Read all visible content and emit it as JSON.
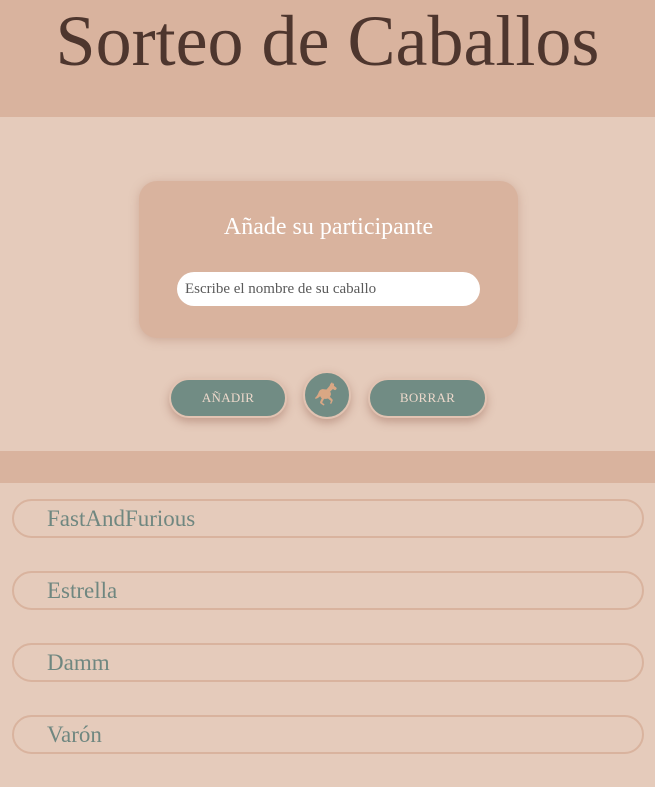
{
  "header": {
    "title": "Sorteo de Caballos"
  },
  "form": {
    "title": "Añade su participante",
    "input_placeholder": "Escribe el nombre de su caballo",
    "input_value": ""
  },
  "actions": {
    "add_label": "AÑADIR",
    "horse_icon": "horse-icon",
    "clear_label": "BORRAR"
  },
  "participants": [
    {
      "name": "FastAndFurious"
    },
    {
      "name": "Estrella"
    },
    {
      "name": "Damm"
    },
    {
      "name": "Varón"
    }
  ],
  "colors": {
    "page_background": "#e5cbbb",
    "header_background": "#d9b39e",
    "title_text": "#4e362e",
    "button_background": "#718c84",
    "button_text": "#ecd8cb",
    "list_text": "#6f8780",
    "horse_icon": "#d9a784"
  }
}
